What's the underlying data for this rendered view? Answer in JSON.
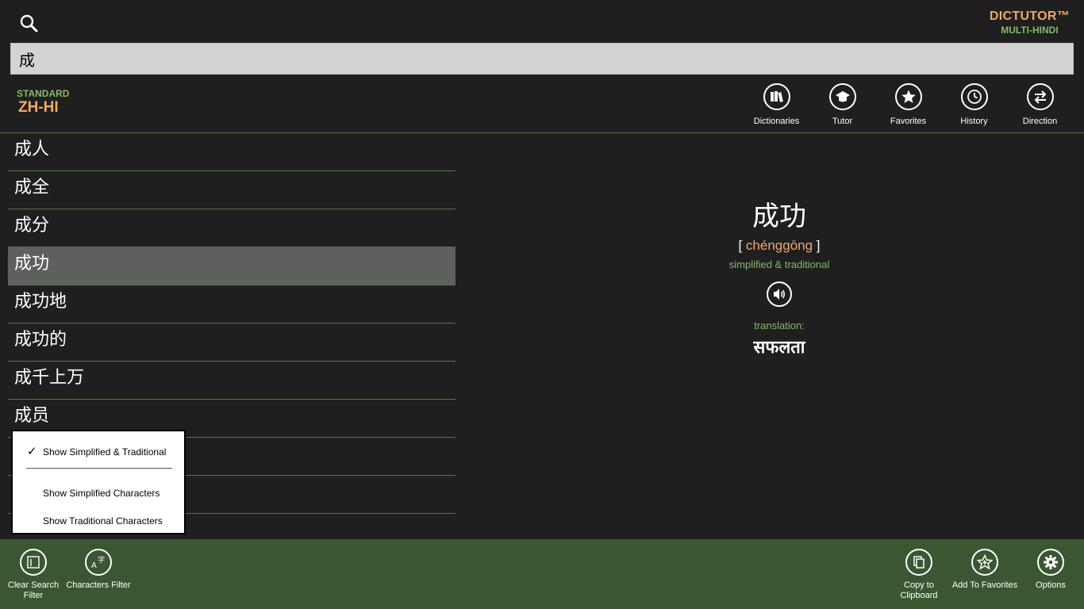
{
  "app": {
    "brand_title": "DICTUTOR™",
    "brand_subtitle": "MULTI-HINDI"
  },
  "search": {
    "value": "成",
    "icon": "search-icon"
  },
  "dictionary": {
    "standard_label": "STANDARD",
    "code": "ZH-HI"
  },
  "top_actions": [
    {
      "label": "Dictionaries",
      "icon": "books-icon"
    },
    {
      "label": "Tutor",
      "icon": "graduation-cap-icon"
    },
    {
      "label": "Favorites",
      "icon": "star-icon"
    },
    {
      "label": "History",
      "icon": "clock-icon"
    },
    {
      "label": "Direction",
      "icon": "swap-arrows-icon"
    }
  ],
  "word_list": {
    "items": [
      "成人",
      "成全",
      "成分",
      "成功",
      "成功地",
      "成功的",
      "成千上万",
      "成员",
      "",
      ""
    ],
    "selected": "成功"
  },
  "detail": {
    "word": "成功",
    "bracket_open": "[",
    "pinyin": "chénggōng",
    "bracket_close": "]",
    "type": "simplified & traditional",
    "speaker_icon": "speaker-icon",
    "translation_label": "translation:",
    "translation": "सफलता"
  },
  "popup_menu": {
    "items": [
      {
        "label": "Show Simplified & Traditional",
        "checked": true
      },
      {
        "label": "Show Simplified Characters",
        "checked": false
      },
      {
        "label": "Show Traditional Characters",
        "checked": false
      }
    ],
    "check_glyph": "✓"
  },
  "app_bar": {
    "left": [
      {
        "label": "Clear Search Filter",
        "icon": "clear-filter-icon"
      },
      {
        "label": "Characters Filter",
        "icon": "characters-filter-icon"
      }
    ],
    "right": [
      {
        "label": "Copy to Clipboard",
        "icon": "copy-icon"
      },
      {
        "label": "Add To Favorites",
        "icon": "star-add-icon"
      },
      {
        "label": "Options",
        "icon": "gear-icon"
      }
    ]
  },
  "colors": {
    "background": "#1f1f1f",
    "accent_orange": "#f0a868",
    "accent_green": "#86b86c",
    "appbar": "#3a5731",
    "selected_row": "#5f5f5f",
    "divider": "#4f7a3f"
  }
}
